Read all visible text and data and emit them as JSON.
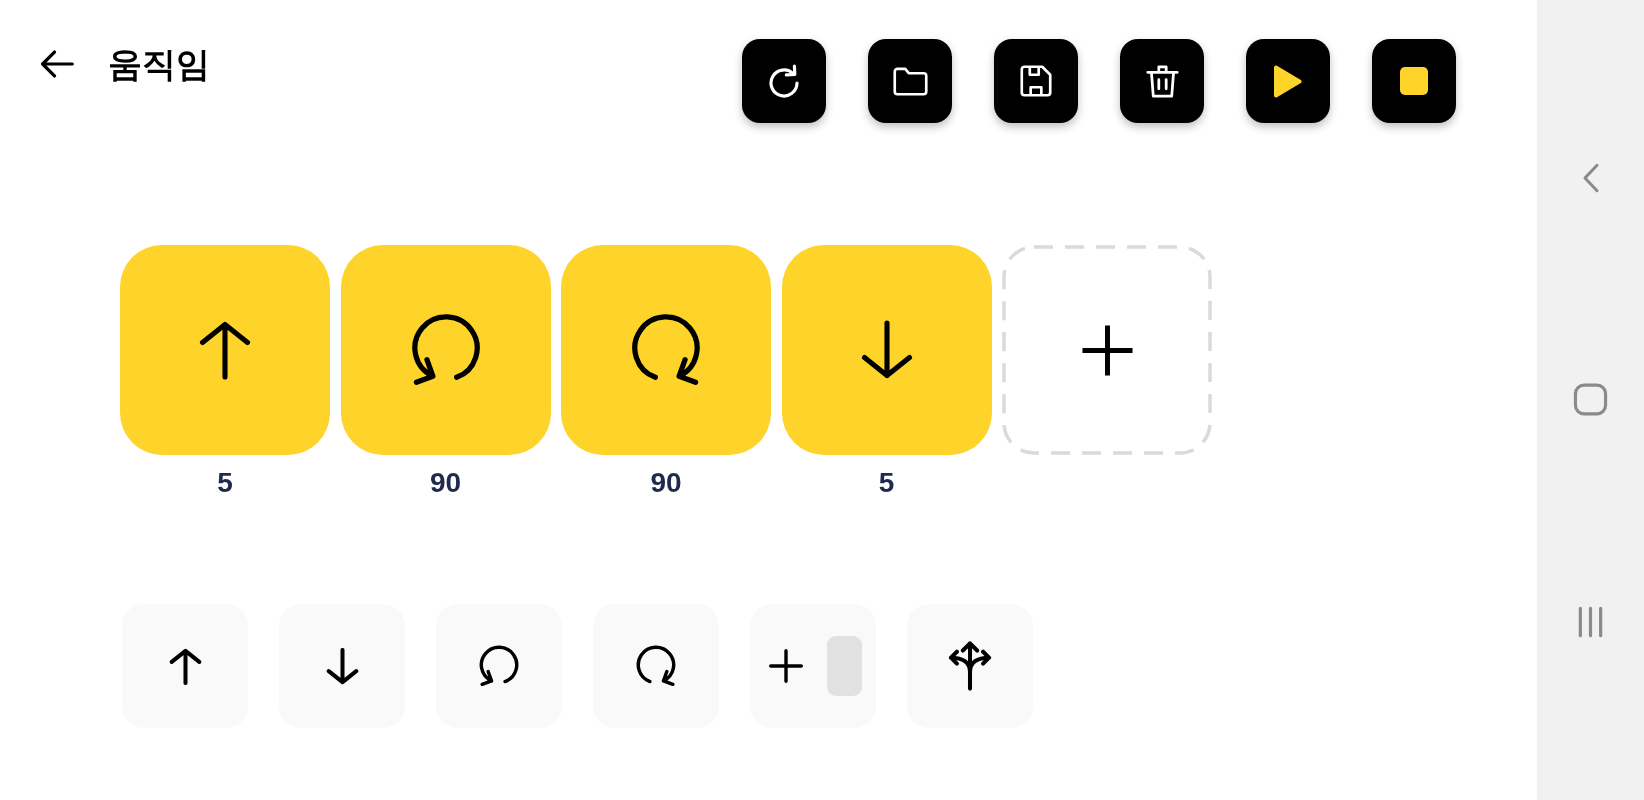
{
  "header": {
    "title": "움직임"
  },
  "program": {
    "blocks": [
      {
        "kind": "forward",
        "value": "5"
      },
      {
        "kind": "turn_left",
        "value": "90"
      },
      {
        "kind": "turn_right",
        "value": "90"
      },
      {
        "kind": "backward",
        "value": "5"
      }
    ]
  },
  "palette": [
    {
      "kind": "forward"
    },
    {
      "kind": "backward"
    },
    {
      "kind": "turn_left"
    },
    {
      "kind": "turn_right"
    },
    {
      "kind": "plus_slot"
    },
    {
      "kind": "split"
    }
  ]
}
